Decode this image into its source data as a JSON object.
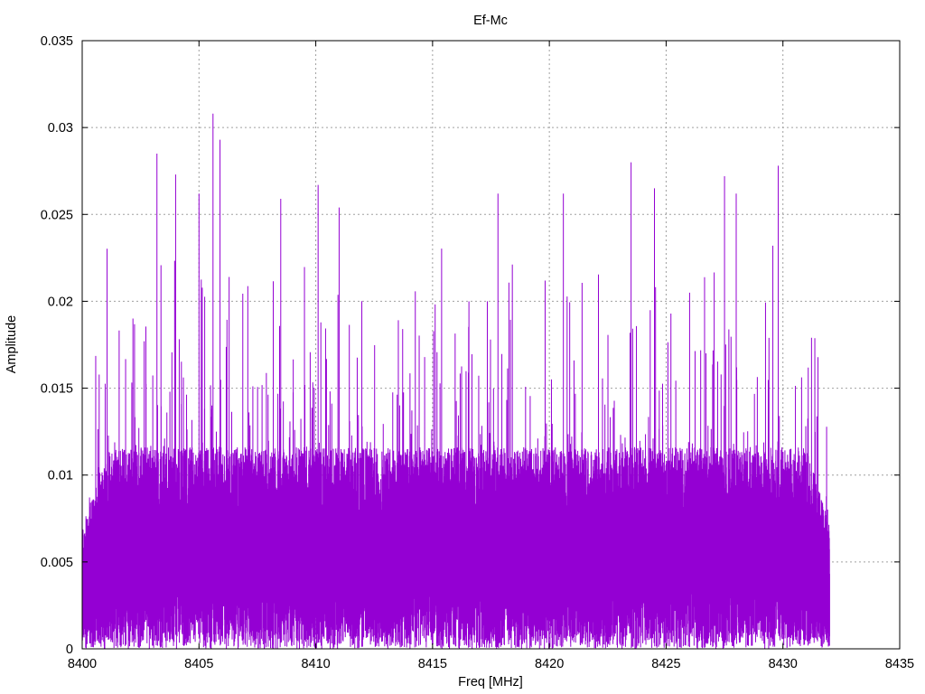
{
  "chart_data": {
    "type": "line",
    "title": "Ef-Mc",
    "xlabel": "Freq [MHz]",
    "ylabel": "Amplitude",
    "xlim": [
      8400,
      8435
    ],
    "ylim": [
      0,
      0.035
    ],
    "xticks": [
      "8400",
      "8405",
      "8410",
      "8415",
      "8420",
      "8425",
      "8430",
      "8435"
    ],
    "yticks": [
      "0",
      "0.005",
      "0.01",
      "0.015",
      "0.02",
      "0.025",
      "0.03",
      "0.035"
    ],
    "grid": true,
    "legend": "none",
    "series": [
      {
        "color": "#9400d3",
        "x_range": [
          8400,
          8432
        ],
        "baseline_amplitude": 0.008,
        "notable_peaks": [
          {
            "x": 8403.2,
            "y": 0.0285
          },
          {
            "x": 8404.0,
            "y": 0.0273
          },
          {
            "x": 8405.0,
            "y": 0.0262
          },
          {
            "x": 8405.6,
            "y": 0.0308
          },
          {
            "x": 8405.9,
            "y": 0.0293
          },
          {
            "x": 8408.5,
            "y": 0.0259
          },
          {
            "x": 8410.1,
            "y": 0.0267
          },
          {
            "x": 8411.0,
            "y": 0.0254
          },
          {
            "x": 8417.8,
            "y": 0.0262
          },
          {
            "x": 8420.6,
            "y": 0.0262
          },
          {
            "x": 8423.5,
            "y": 0.028
          },
          {
            "x": 8424.5,
            "y": 0.0265
          },
          {
            "x": 8427.5,
            "y": 0.0272
          },
          {
            "x": 8428.0,
            "y": 0.0262
          },
          {
            "x": 8429.8,
            "y": 0.0278
          }
        ]
      }
    ]
  }
}
